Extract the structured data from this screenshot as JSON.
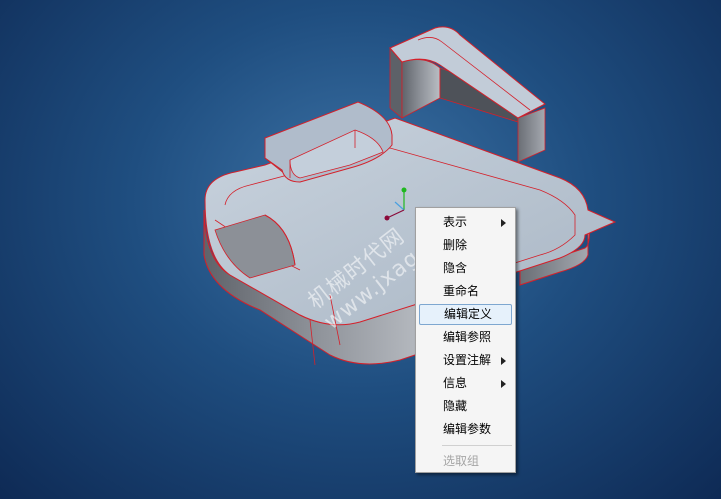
{
  "colors": {
    "background_center": "#3d73a6",
    "background_edge": "#0e2a55",
    "part_top": "#b5c2d0",
    "part_side": "#7b7f86",
    "edge": "#d4202a",
    "menu_bg": "#f5f5f5",
    "menu_highlight": "#e6f1fb"
  },
  "watermark": {
    "line1": "机械时代网",
    "line2": "www.jxage.com"
  },
  "context_menu": {
    "items": [
      {
        "label": "表示",
        "submenu": true,
        "highlighted": false,
        "disabled": false
      },
      {
        "label": "删除",
        "submenu": false,
        "highlighted": false,
        "disabled": false
      },
      {
        "label": "隐含",
        "submenu": false,
        "highlighted": false,
        "disabled": false
      },
      {
        "label": "重命名",
        "submenu": false,
        "highlighted": false,
        "disabled": false
      },
      {
        "label": "编辑定义",
        "submenu": false,
        "highlighted": true,
        "disabled": false
      },
      {
        "label": "编辑参照",
        "submenu": false,
        "highlighted": false,
        "disabled": false
      },
      {
        "label": "设置注解",
        "submenu": true,
        "highlighted": false,
        "disabled": false
      },
      {
        "label": "信息",
        "submenu": true,
        "highlighted": false,
        "disabled": false
      },
      {
        "label": "隐藏",
        "submenu": false,
        "highlighted": false,
        "disabled": false
      },
      {
        "label": "编辑参数",
        "submenu": false,
        "highlighted": false,
        "disabled": false
      },
      {
        "label": "选取组",
        "submenu": false,
        "highlighted": false,
        "disabled": true
      }
    ]
  }
}
